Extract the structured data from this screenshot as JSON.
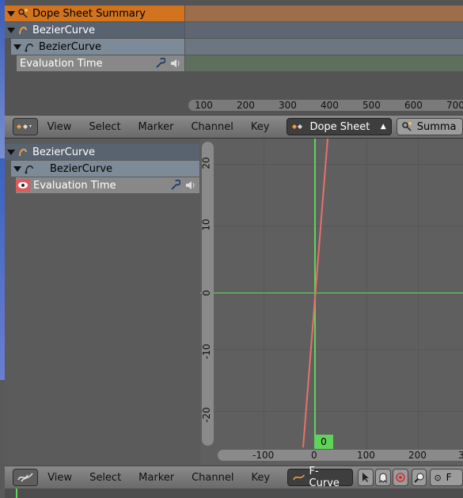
{
  "top_channels": {
    "summary_label": "Dope Sheet Summary",
    "object_label": "BezierCurve",
    "data_label": "BezierCurve",
    "channel_label": "Evaluation Time"
  },
  "top_ruler": {
    "ticks": [
      "100",
      "200",
      "300",
      "400",
      "500",
      "600",
      "700"
    ]
  },
  "dope_header": {
    "menus": [
      "View",
      "Select",
      "Marker",
      "Channel",
      "Key"
    ],
    "mode": "Dope Sheet",
    "summary_button": "Summa"
  },
  "graph_channels": {
    "object_label": "BezierCurve",
    "data_label": "BezierCurve",
    "channel_label": "Evaluation Time"
  },
  "graph": {
    "y_ticks": [
      "20",
      "10",
      "0",
      "-10",
      "-20"
    ],
    "x_ticks": [
      "-100",
      "0",
      "100",
      "200",
      "3"
    ],
    "current_frame": "0"
  },
  "graph_header": {
    "menus": [
      "View",
      "Select",
      "Marker",
      "Channel",
      "Key"
    ],
    "mode": "F-Curve",
    "pivot_label": "F"
  },
  "colors": {
    "accent_summary": "#d2731d",
    "curve_red": "#e8706b",
    "playhead_green": "#5fd35a",
    "x_axis_green": "#5fa35a"
  }
}
